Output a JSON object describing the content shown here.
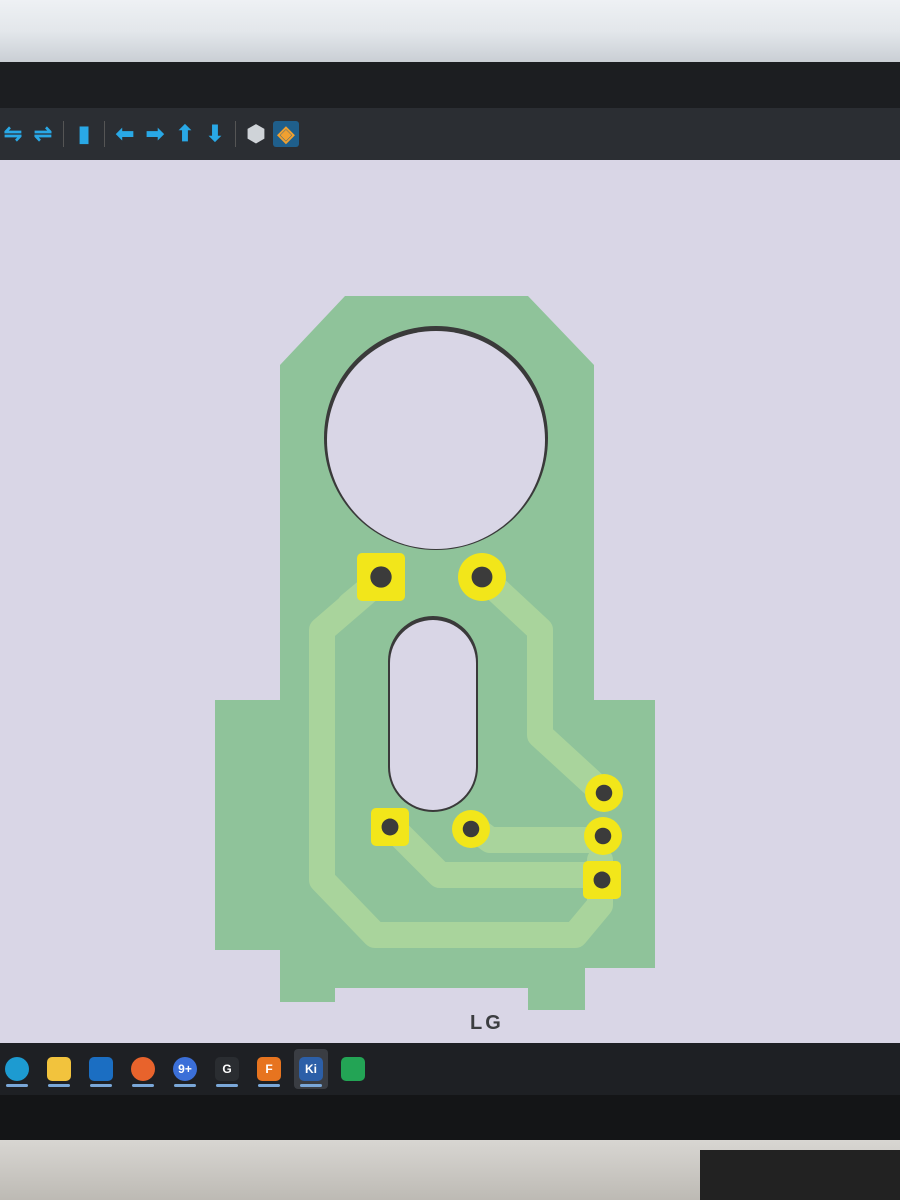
{
  "toolbar": {
    "buttons": [
      {
        "name": "flip-x-icon",
        "glyph": "⇋"
      },
      {
        "name": "flip-y-icon",
        "glyph": "⇌"
      },
      {
        "name": "layers-toggle-icon",
        "glyph": "▮"
      },
      {
        "name": "arrow-left-icon",
        "glyph": "⬅"
      },
      {
        "name": "arrow-right-icon",
        "glyph": "➡"
      },
      {
        "name": "arrow-up-icon",
        "glyph": "⬆"
      },
      {
        "name": "arrow-down-icon",
        "glyph": "⬇"
      },
      {
        "name": "3d-box-icon",
        "glyph": "⬢"
      },
      {
        "name": "layer-stack-icon",
        "glyph": "◈"
      }
    ]
  },
  "colors": {
    "canvas_bg": "#d9d6e6",
    "board": "#8fc39a",
    "trace": "#a9d49c",
    "pad": "#f2e61a",
    "drill": "#3b3b3b",
    "toolbar_accent": "#29a8e6"
  },
  "taskbar": {
    "apps": [
      {
        "name": "edge-icon",
        "label": "",
        "color": "#1d9bd1"
      },
      {
        "name": "file-explorer-icon",
        "label": "",
        "color": "#f2c33d"
      },
      {
        "name": "outlook-icon",
        "label": "",
        "color": "#1b6ec2"
      },
      {
        "name": "firefox-icon",
        "label": "",
        "color": "#e8632c"
      },
      {
        "name": "chrome-icon",
        "label": "9+",
        "color": "#3b6fd8"
      },
      {
        "name": "logitech-icon",
        "label": "G",
        "color": "#2a2d31"
      },
      {
        "name": "fusion-icon",
        "label": "F",
        "color": "#e7741f"
      },
      {
        "name": "kicad-icon",
        "label": "Ki",
        "color": "#2c5fa8"
      },
      {
        "name": "sheets-icon",
        "label": "",
        "color": "#23a455"
      }
    ]
  },
  "monitor": {
    "brand": "LG"
  }
}
